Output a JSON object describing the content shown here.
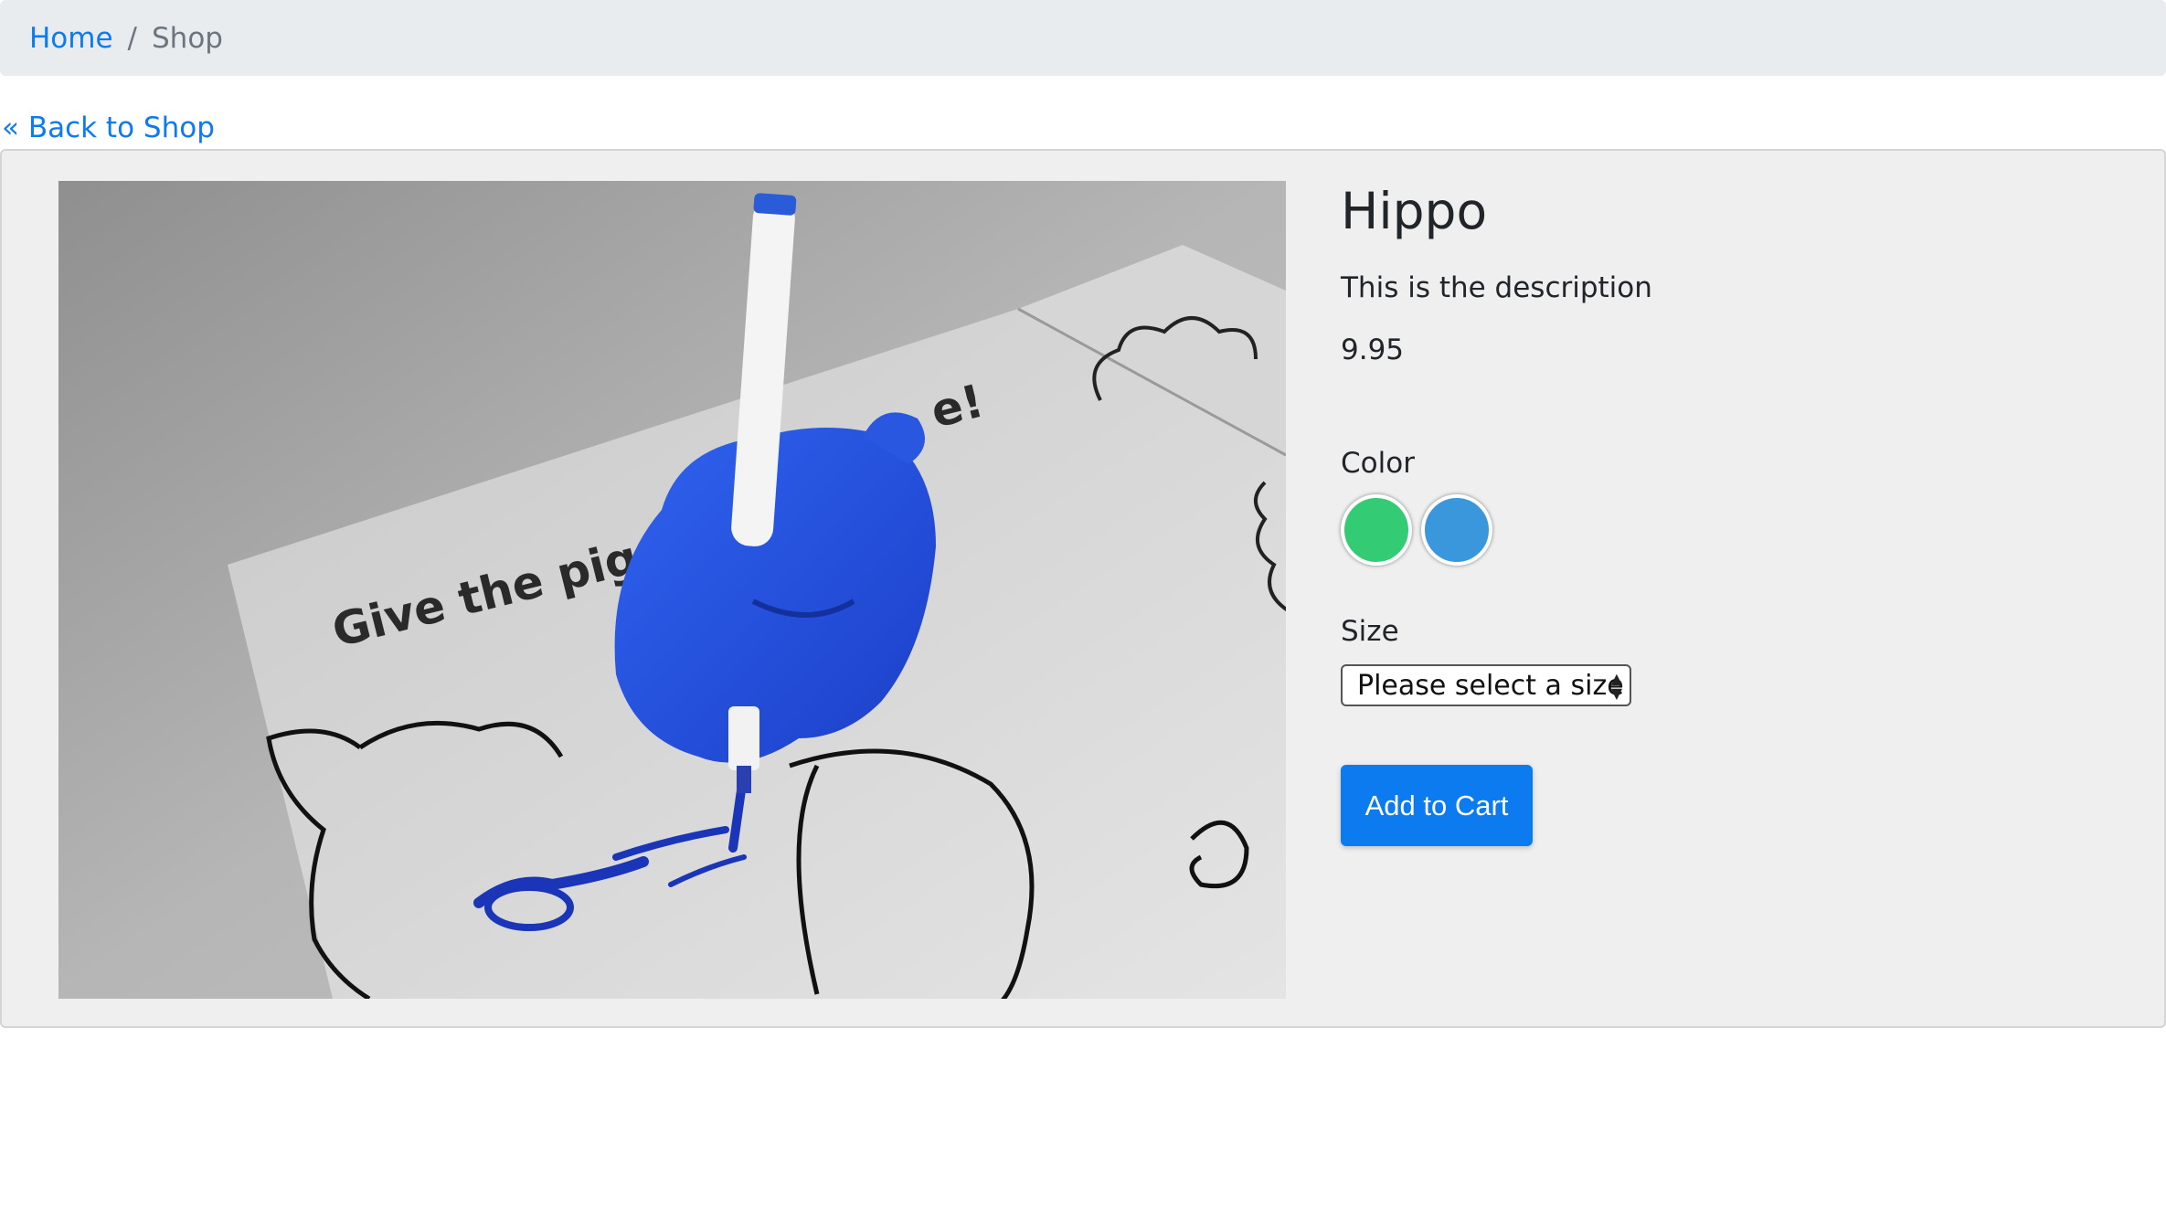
{
  "breadcrumb": {
    "items": [
      {
        "label": "Home"
      },
      {
        "label": "Shop"
      }
    ],
    "separator": "/"
  },
  "back_link": "« Back to Shop",
  "product": {
    "title": "Hippo",
    "description": "This is the description",
    "price": "9.95",
    "image_text": "Give the piggy ... e!",
    "color_label": "Color",
    "colors": [
      "#33cc75",
      "#3a97dc"
    ],
    "size_label": "Size",
    "size_select": {
      "selected": "Please select a size"
    },
    "add_to_cart_label": "Add to Cart"
  },
  "theme": {
    "link_color": "#0d7bf0",
    "breadcrumb_bg": "#e9ecef",
    "card_bg": "#efefef",
    "button_bg": "#0d7bf0"
  }
}
